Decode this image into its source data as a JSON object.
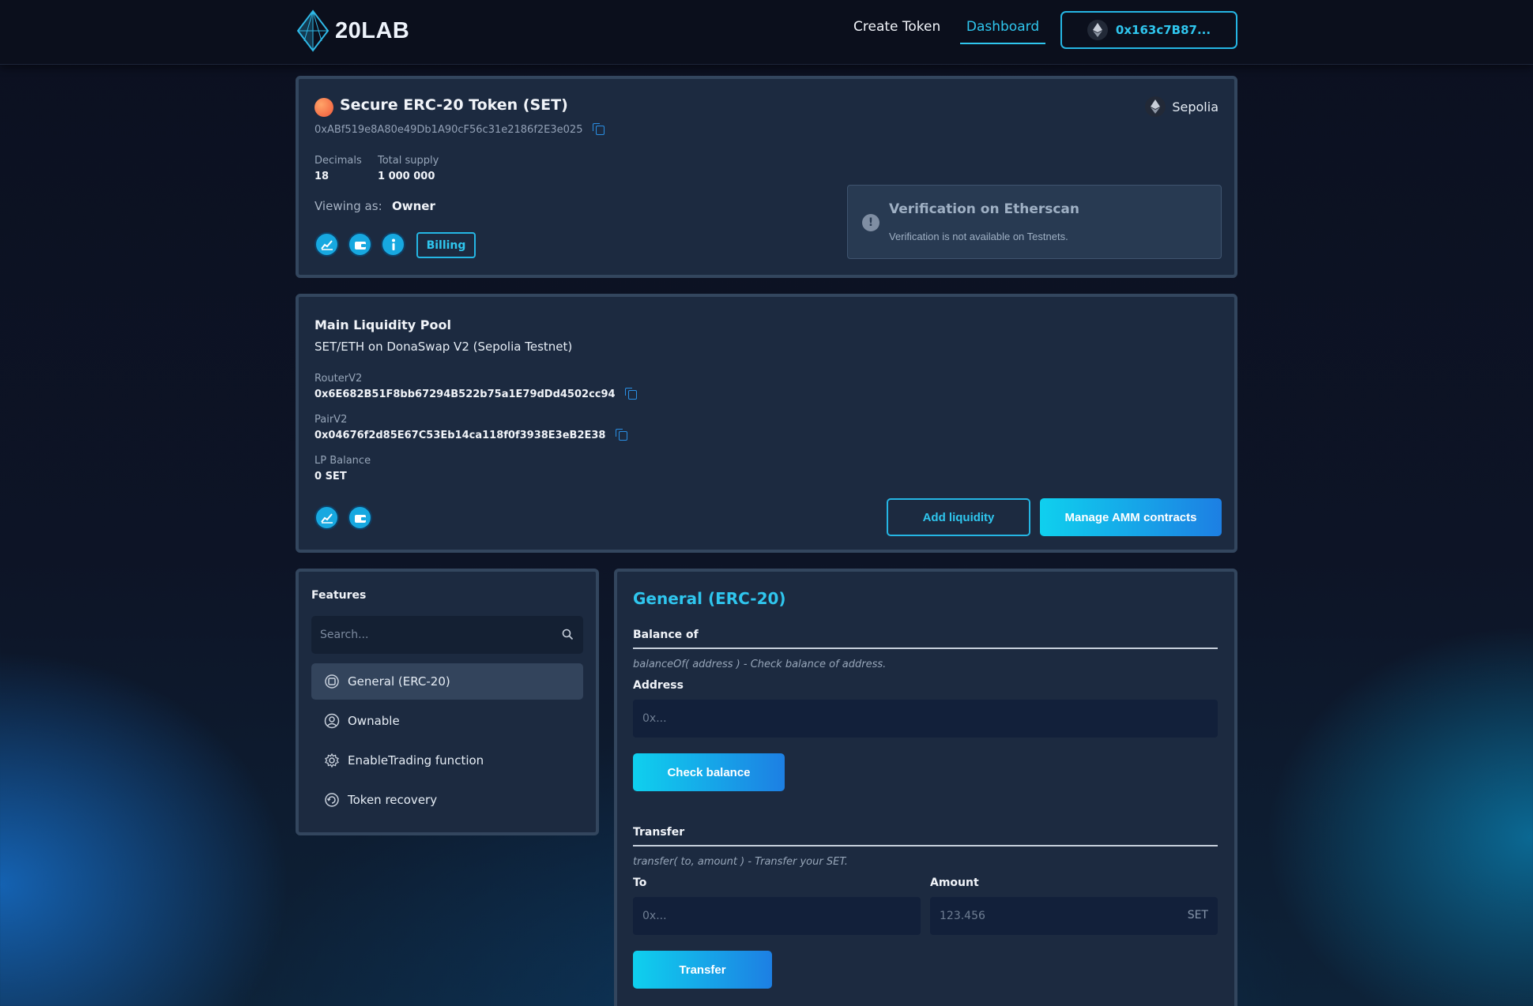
{
  "header": {
    "logo_text": "20LAB",
    "nav": {
      "create_token": "Create Token",
      "dashboard": "Dashboard"
    },
    "wallet_address": "0x163c7B87..."
  },
  "token": {
    "title": "Secure ERC-20 Token (SET)",
    "address": "0xABf519e8A80e49Db1A90cF56c31e2186f2E3e025",
    "network": "Sepolia",
    "decimals_label": "Decimals",
    "decimals_value": "18",
    "supply_label": "Total supply",
    "supply_value": "1 000 000",
    "viewing_label": "Viewing as:",
    "viewing_value": "Owner",
    "billing_label": "Billing",
    "verification": {
      "title": "Verification on Etherscan",
      "text": "Verification is not available on Testnets."
    }
  },
  "pool": {
    "title": "Main Liquidity Pool",
    "subtitle": "SET/ETH on DonaSwap V2 (Sepolia Testnet)",
    "router_label": "RouterV2",
    "router_value": "0x6E682B51F8bb67294B522b75a1E79dDd4502cc94",
    "pair_label": "PairV2",
    "pair_value": "0x04676f2d85E67C53Eb14ca118f0f3938E3eB2E38",
    "lp_label": "LP Balance",
    "lp_value": "0 SET",
    "add_liquidity": "Add liquidity",
    "manage_amm": "Manage AMM contracts"
  },
  "features": {
    "title": "Features",
    "search_placeholder": "Search...",
    "items": [
      {
        "label": "General (ERC-20)",
        "icon": "chip-icon",
        "active": true
      },
      {
        "label": "Ownable",
        "icon": "user-circle-icon",
        "active": false
      },
      {
        "label": "EnableTrading function",
        "icon": "gear-icon",
        "active": false
      },
      {
        "label": "Token recovery",
        "icon": "recovery-icon",
        "active": false
      }
    ]
  },
  "general": {
    "title": "General (ERC-20)",
    "balance": {
      "heading": "Balance of",
      "description": "balanceOf( address ) - Check balance of address.",
      "address_label": "Address",
      "address_placeholder": "0x...",
      "button": "Check balance"
    },
    "transfer": {
      "heading": "Transfer",
      "description": "transfer( to, amount ) - Transfer your SET.",
      "to_label": "To",
      "to_placeholder": "0x...",
      "amount_label": "Amount",
      "amount_placeholder": "123.456",
      "amount_unit": "SET",
      "button": "Transfer"
    }
  },
  "colors": {
    "accent": "#2fc6ee",
    "card_bg": "#1c2a40",
    "card_border": "#33465e",
    "page_bg": "#0c1020"
  }
}
